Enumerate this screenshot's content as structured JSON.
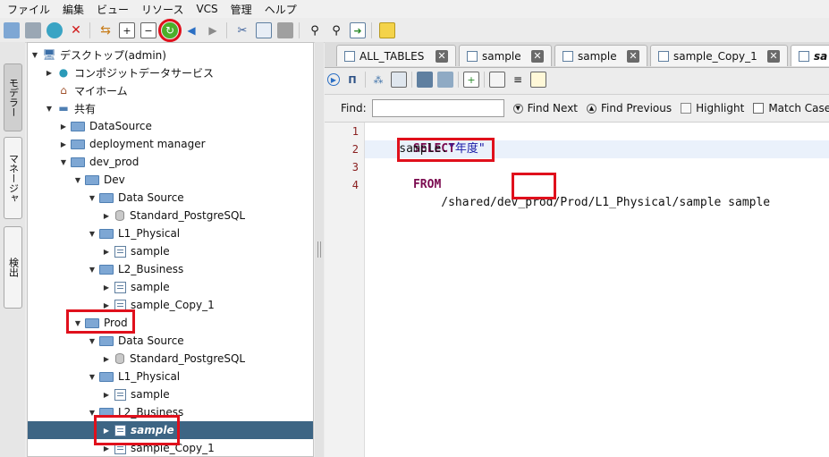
{
  "menu": [
    "ファイル",
    "編集",
    "ビュー",
    "リソース",
    "VCS",
    "管理",
    "ヘルプ"
  ],
  "toolbar_icons": [
    "folder-open-icon",
    "save-icon",
    "globe-icon",
    "delete-icon",
    "separator",
    "undo-icon",
    "expand-icon",
    "collapse-icon",
    "refresh-icon",
    "back-icon",
    "forward-icon",
    "separator",
    "cut-icon",
    "copy-icon",
    "paste-icon",
    "separator",
    "binoculars-icon",
    "binoculars-next-icon",
    "export-icon",
    "separator",
    "note-icon"
  ],
  "side_tabs": [
    "モデラー",
    "マネージャ",
    "検出"
  ],
  "tree": [
    {
      "label": "デスクトップ(admin)",
      "icon": "monitor-icon",
      "level": 0,
      "expanded": true
    },
    {
      "label": "コンポジットデータサービス",
      "icon": "globe-icon",
      "level": 1,
      "expanded": false
    },
    {
      "label": "マイホーム",
      "icon": "home-icon",
      "level": 1,
      "expanded": null
    },
    {
      "label": "共有",
      "icon": "shared-folder-icon",
      "level": 1,
      "expanded": true
    },
    {
      "label": "DataSource",
      "icon": "folder-icon",
      "level": 2,
      "expanded": false
    },
    {
      "label": "deployment manager",
      "icon": "folder-icon",
      "level": 2,
      "expanded": false
    },
    {
      "label": "dev_prod",
      "icon": "folder-icon",
      "level": 2,
      "expanded": true
    },
    {
      "label": "Dev",
      "icon": "folder-icon",
      "level": 3,
      "expanded": true
    },
    {
      "label": "Data Source",
      "icon": "folder-icon",
      "level": 4,
      "expanded": true
    },
    {
      "label": "Standard_PostgreSQL",
      "icon": "database-icon",
      "level": 5,
      "expanded": false
    },
    {
      "label": "L1_Physical",
      "icon": "folder-icon",
      "level": 4,
      "expanded": true
    },
    {
      "label": "sample",
      "icon": "view-icon",
      "level": 5,
      "expanded": false
    },
    {
      "label": "L2_Business",
      "icon": "folder-icon",
      "level": 4,
      "expanded": true
    },
    {
      "label": "sample",
      "icon": "view-icon",
      "level": 5,
      "expanded": false
    },
    {
      "label": "sample_Copy_1",
      "icon": "view-icon",
      "level": 5,
      "expanded": false
    },
    {
      "label": "Prod",
      "icon": "folder-icon",
      "level": 3,
      "expanded": true
    },
    {
      "label": "Data Source",
      "icon": "folder-icon",
      "level": 4,
      "expanded": true
    },
    {
      "label": "Standard_PostgreSQL",
      "icon": "database-icon",
      "level": 5,
      "expanded": false
    },
    {
      "label": "L1_Physical",
      "icon": "folder-icon",
      "level": 4,
      "expanded": true
    },
    {
      "label": "sample",
      "icon": "view-icon",
      "level": 5,
      "expanded": false
    },
    {
      "label": "L2_Business",
      "icon": "folder-icon",
      "level": 4,
      "expanded": true
    },
    {
      "label": "sample",
      "icon": "view-icon",
      "level": 5,
      "expanded": false,
      "selected": true
    },
    {
      "label": "sample_Copy_1",
      "icon": "view-icon",
      "level": 5,
      "expanded": false
    }
  ],
  "tabs": [
    "ALL_TABLES",
    "sample",
    "sample",
    "sample_Copy_1",
    "sa"
  ],
  "find": {
    "label": "Find:",
    "value": "",
    "find_next": "Find Next",
    "find_previous": "Find Previous",
    "highlight": "Highlight",
    "match_case": "Match Case"
  },
  "code": {
    "line_numbers": [
      "1",
      "2",
      "3",
      "4"
    ],
    "l1_kw": "SELECT",
    "l2_pre": "    sample.",
    "l2_str": "\"年度\"",
    "l3_kw": "FROM",
    "l4": "    /shared/dev_prod/Prod/L1_Physical/sample sample"
  }
}
